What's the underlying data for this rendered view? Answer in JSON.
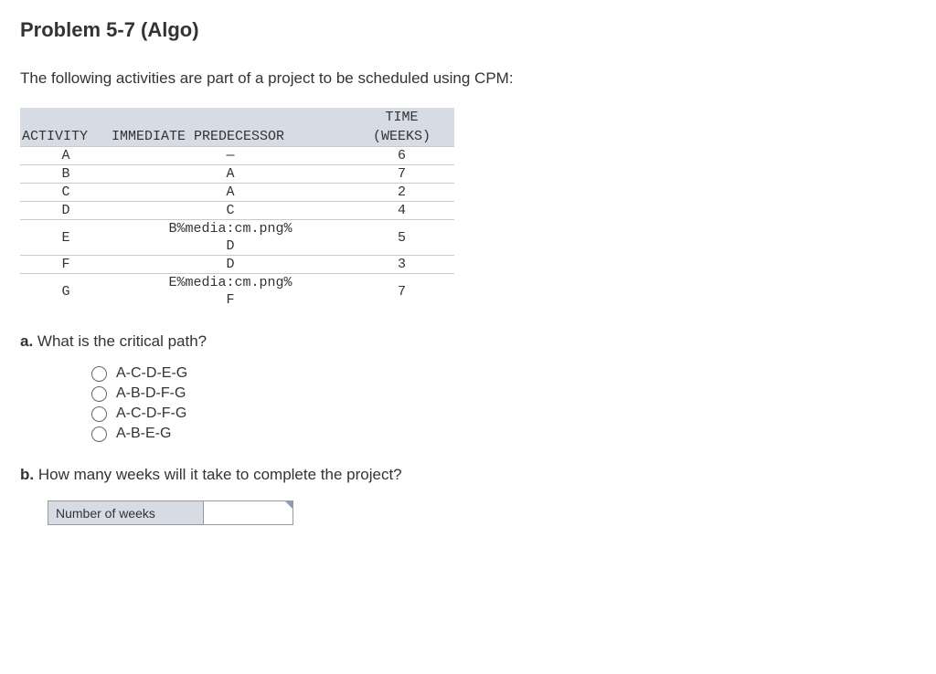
{
  "title": "Problem 5-7 (Algo)",
  "intro": "The following activities are part of a project to be scheduled using CPM:",
  "table": {
    "header": {
      "activity": "ACTIVITY",
      "predecessor": "IMMEDIATE PREDECESSOR",
      "time_line1": "TIME",
      "time_line2": "(WEEKS)"
    },
    "rows": [
      {
        "activity": "A",
        "pred": "—",
        "time": "6"
      },
      {
        "activity": "B",
        "pred": "A",
        "time": "7"
      },
      {
        "activity": "C",
        "pred": "A",
        "time": "2"
      },
      {
        "activity": "D",
        "pred": "C",
        "time": "4"
      },
      {
        "activity": "E",
        "pred": "B%media:cm.png%\nD",
        "time": "5"
      },
      {
        "activity": "F",
        "pred": "D",
        "time": "3"
      },
      {
        "activity": "G",
        "pred": "E%media:cm.png%\nF",
        "time": "7"
      }
    ]
  },
  "q_a": {
    "label": "a.",
    "text": "What is the critical path?",
    "options": [
      "A-C-D-E-G",
      "A-B-D-F-G",
      "A-C-D-F-G",
      "A-B-E-G"
    ]
  },
  "q_b": {
    "label": "b.",
    "text": "How many weeks will it take to complete the project?",
    "input_label": "Number of weeks",
    "input_value": ""
  }
}
